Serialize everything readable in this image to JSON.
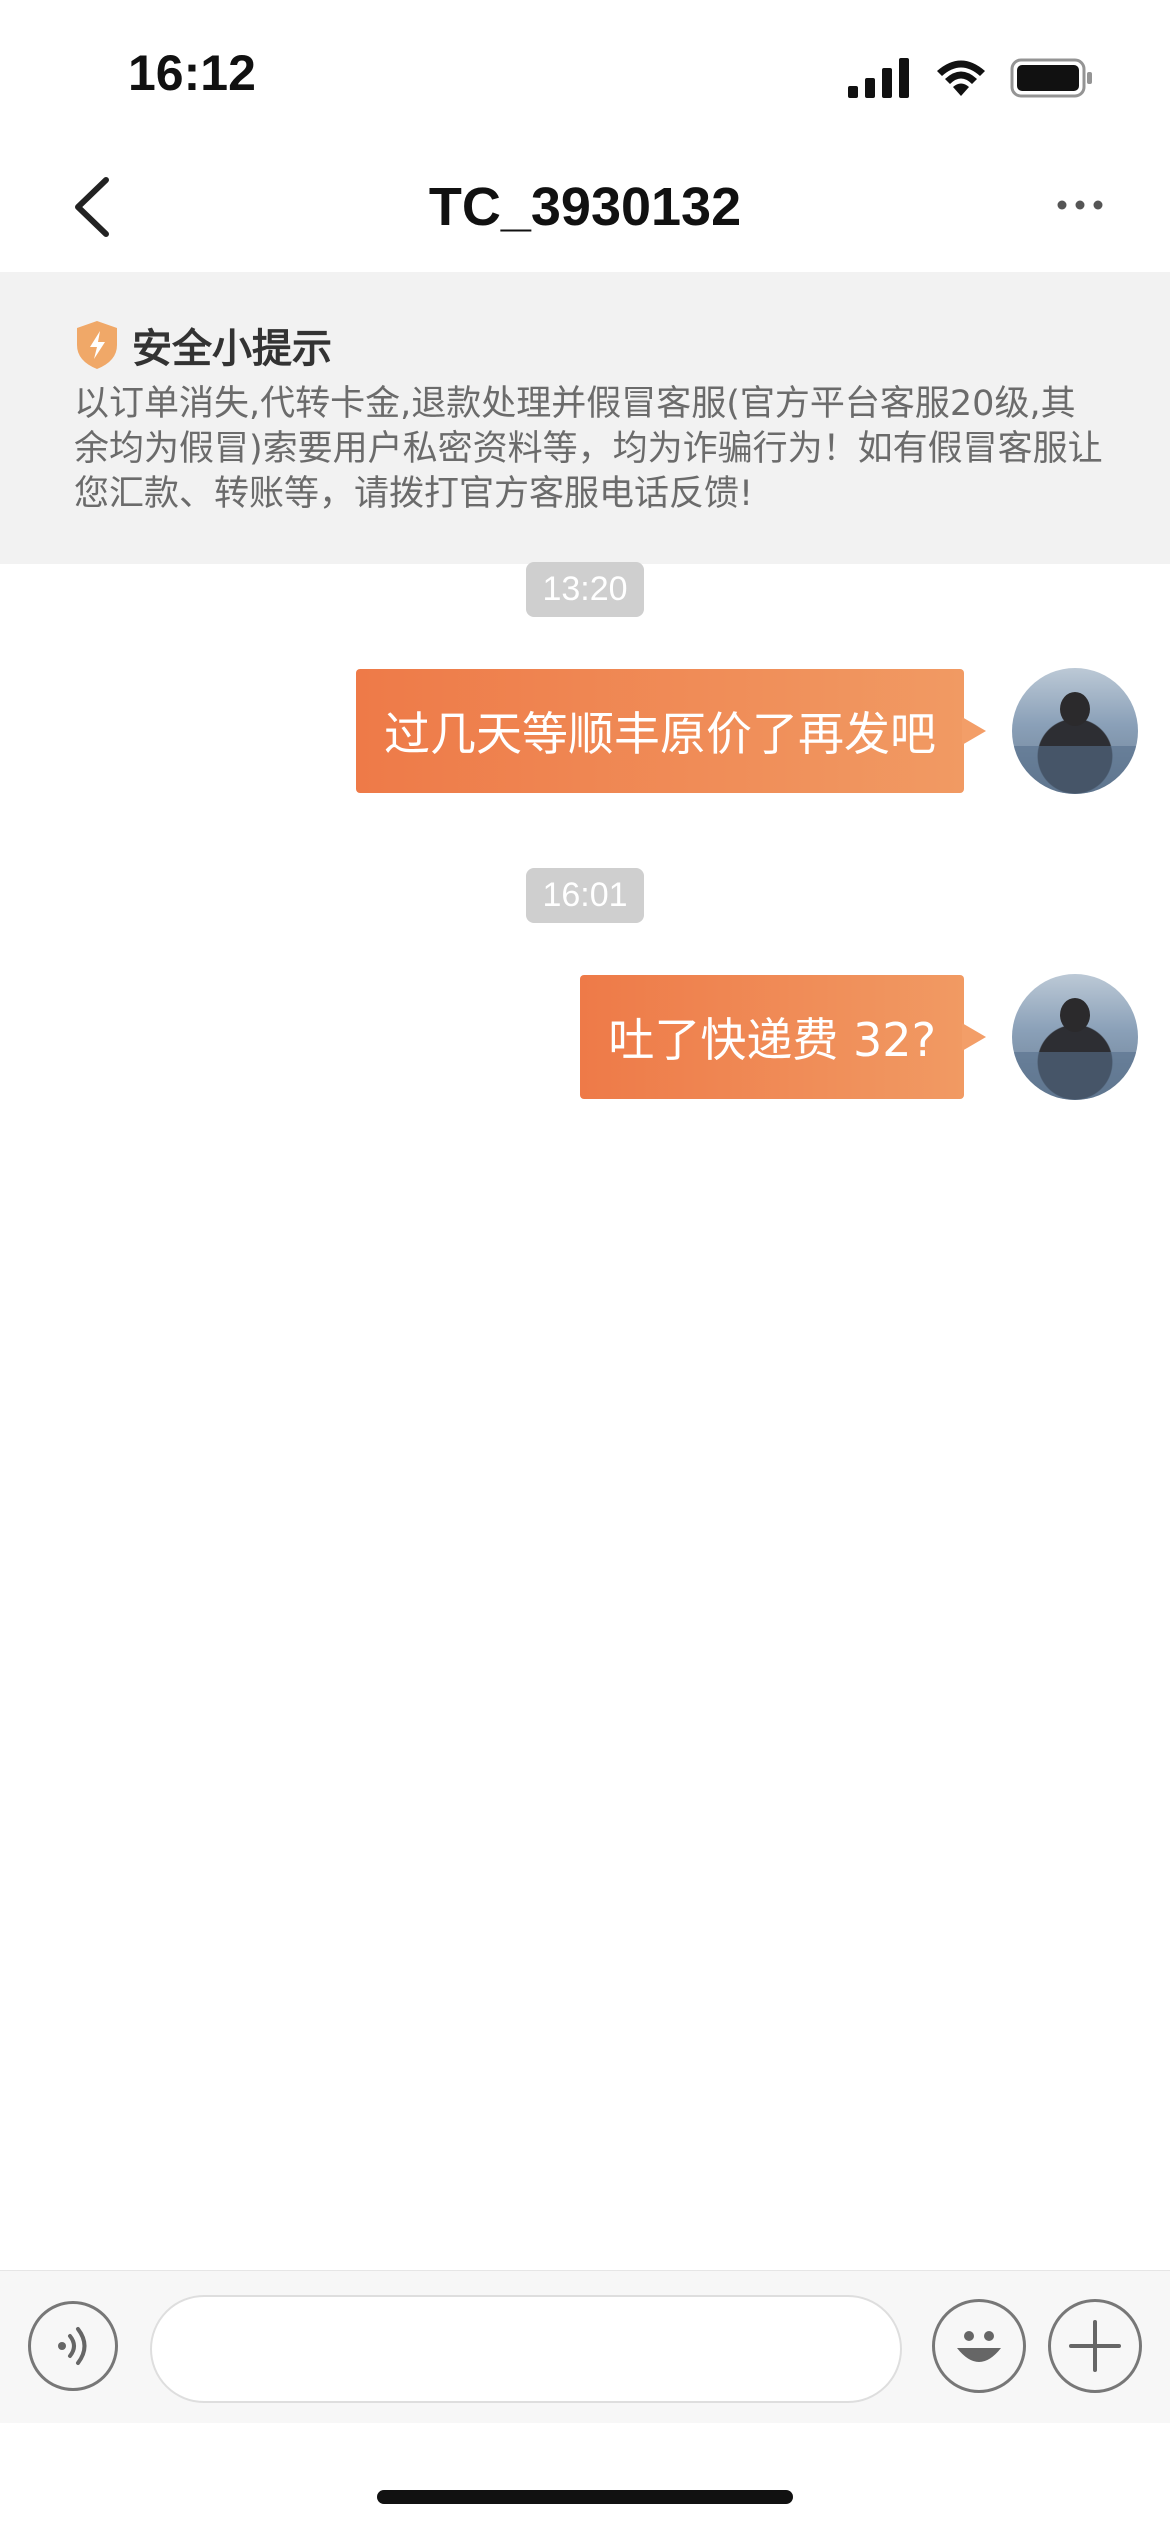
{
  "status_bar": {
    "time": "16:12"
  },
  "header": {
    "title": "TC_3930132"
  },
  "safety_notice": {
    "title": "安全小提示",
    "body": "以订单消失,代转卡金,退款处理并假冒客服(官方平台客服20级,其余均为假冒)索要用户私密资料等，均为诈骗行为！如有假冒客服让您汇款、转账等，请拨打官方客服电话反馈!"
  },
  "messages": [
    {
      "time": "13:20",
      "text": "过几天等顺丰原价了再发吧"
    },
    {
      "time": "16:01",
      "text": "吐了快递费 32?"
    }
  ],
  "input_bar": {
    "placeholder": ""
  },
  "colors": {
    "bubble_start": "#ee7a48",
    "bubble_end": "#f19a63",
    "shield": "#f0a868"
  }
}
